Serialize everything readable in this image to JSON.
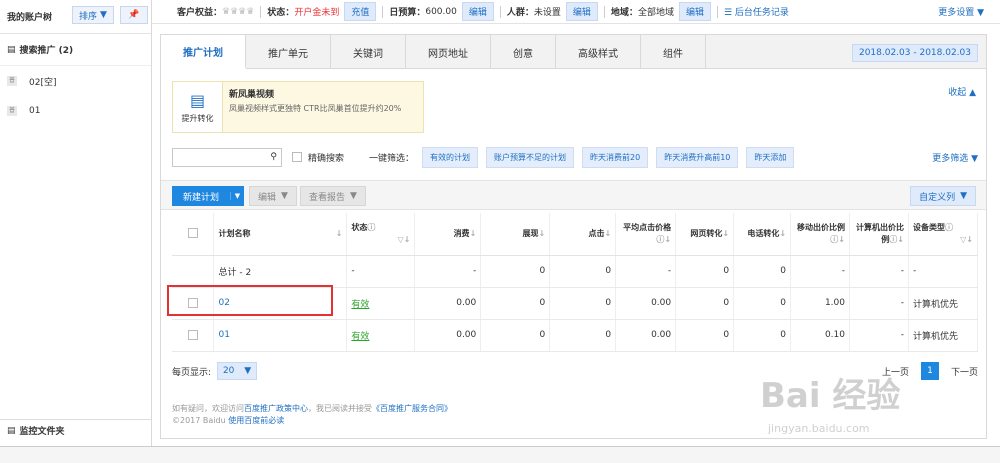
{
  "sidebar": {
    "title": "我的账户树",
    "sort_label": "排序",
    "root": "搜索推广 (2)",
    "items": [
      {
        "tag": "普",
        "label": "02[空]"
      },
      {
        "tag": "普",
        "label": "01"
      }
    ],
    "footer": "监控文件夹"
  },
  "topbar": {
    "rights_label": "客户权益：",
    "status_label": "状态：",
    "status_value": "开户金未到",
    "recharge": "充值",
    "budget_label": "日预算：",
    "budget_value": "600.00",
    "edit": "编辑",
    "crowd_label": "人群：",
    "crowd_value": "未设置",
    "region_label": "地域：",
    "region_value": "全部地域",
    "task_log": "后台任务记录",
    "more_settings": "更多设置"
  },
  "tabs": [
    "推广计划",
    "推广单元",
    "关键词",
    "网页地址",
    "创意",
    "高级样式",
    "组件"
  ],
  "date_range": "2018.02.03 - 2018.02.03",
  "promo": {
    "icon_label": "提升转化",
    "title": "新凤巢视频",
    "desc": "凤巢视频样式更独特 CTR比凤巢首位提升约20%"
  },
  "collapse": "收起",
  "filter": {
    "exact_search": "精确搜索",
    "quick_label": "一键筛选：",
    "quick_buttons": [
      "有效的计划",
      "账户预算不足的计划",
      "昨天消费前20",
      "昨天消费升高前10",
      "昨天添加"
    ],
    "more": "更多筛选"
  },
  "toolbar": {
    "new_plan": "新建计划",
    "edit": "编辑",
    "view_report": "查看报告",
    "custom_cols": "自定义列"
  },
  "table": {
    "headers": [
      "计划名称",
      "状态",
      "消费",
      "展现",
      "点击",
      "平均点击价格",
      "网页转化",
      "电话转化",
      "移动出价比例",
      "计算机出价比例",
      "设备类型"
    ],
    "total": [
      "总计 - 2",
      "-",
      "-",
      "0",
      "0",
      "-",
      "0",
      "0",
      "-",
      "-",
      "-"
    ],
    "rows": [
      [
        "02",
        "有效",
        "0.00",
        "0",
        "0",
        "0.00",
        "0",
        "0",
        "1.00",
        "-",
        "计算机优先"
      ],
      [
        "01",
        "有效",
        "0.00",
        "0",
        "0",
        "0.00",
        "0",
        "0",
        "0.10",
        "-",
        "计算机优先"
      ]
    ]
  },
  "pager": {
    "per_page_label": "每页显示:",
    "per_page": "20",
    "prev": "上一页",
    "current": "1",
    "next": "下一页"
  },
  "footer": {
    "line1_a": "如有疑问，欢迎访问",
    "line1_link1": "百度推广政策中心",
    "line1_b": "，我已阅读并接受",
    "line1_link2": "《百度推广服务合同》",
    "line2_a": "©2017 Baidu",
    "line2_link": "使用百度前必读"
  },
  "watermark": {
    "main": "Bai 经验",
    "sub": "jingyan.baidu.com"
  }
}
